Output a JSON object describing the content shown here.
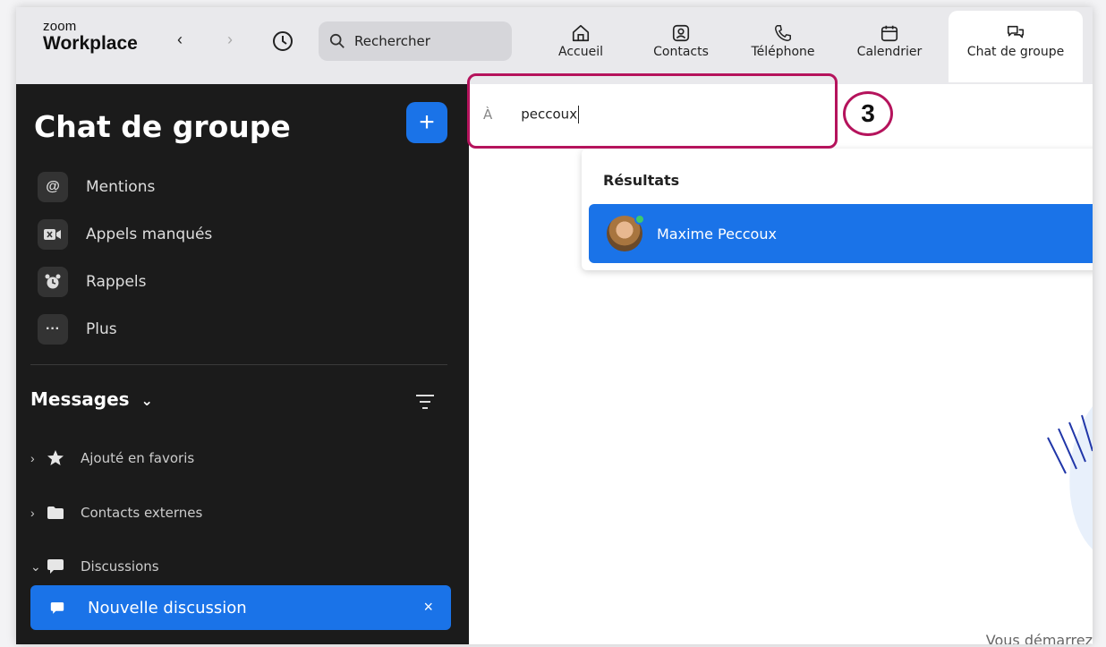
{
  "app": {
    "logo_small": "zoom",
    "logo_big": "Workplace"
  },
  "search": {
    "placeholder": "Rechercher"
  },
  "tabs": [
    {
      "label": "Accueil",
      "icon": "home-icon"
    },
    {
      "label": "Contacts",
      "icon": "contacts-icon"
    },
    {
      "label": "Téléphone",
      "icon": "phone-icon"
    },
    {
      "label": "Calendrier",
      "icon": "calendar-icon"
    },
    {
      "label": "Chat de groupe",
      "icon": "chat-icon",
      "active": true
    }
  ],
  "sidebar": {
    "title": "Chat de groupe",
    "add_label": "+",
    "items": [
      {
        "label": "Mentions",
        "icon": "at-icon"
      },
      {
        "label": "Appels manqués",
        "icon": "missed-call-icon"
      },
      {
        "label": "Rappels",
        "icon": "alarm-icon"
      },
      {
        "label": "Plus",
        "icon": "more-icon"
      }
    ],
    "messages_header": "Messages",
    "groups": [
      {
        "label": "Ajouté en favoris",
        "icon": "star-icon",
        "expanded": false
      },
      {
        "label": "Contacts externes",
        "icon": "folder-icon",
        "expanded": false
      },
      {
        "label": "Discussions",
        "icon": "chat-bubble-icon",
        "expanded": true
      }
    ],
    "new_discussion": {
      "label": "Nouvelle discussion",
      "close": "×"
    }
  },
  "compose": {
    "to_label": "À",
    "to_value": "peccoux",
    "annotation_number": "3"
  },
  "results": {
    "header": "Résultats",
    "items": [
      {
        "name": "Maxime Peccoux",
        "status": "online"
      }
    ]
  },
  "main": {
    "footer_text": "Vous démarrez"
  },
  "colors": {
    "accent": "#1a73e8",
    "annotation": "#b5135c",
    "sidebar_bg": "#1b1b1b",
    "online": "#3ec96b"
  }
}
